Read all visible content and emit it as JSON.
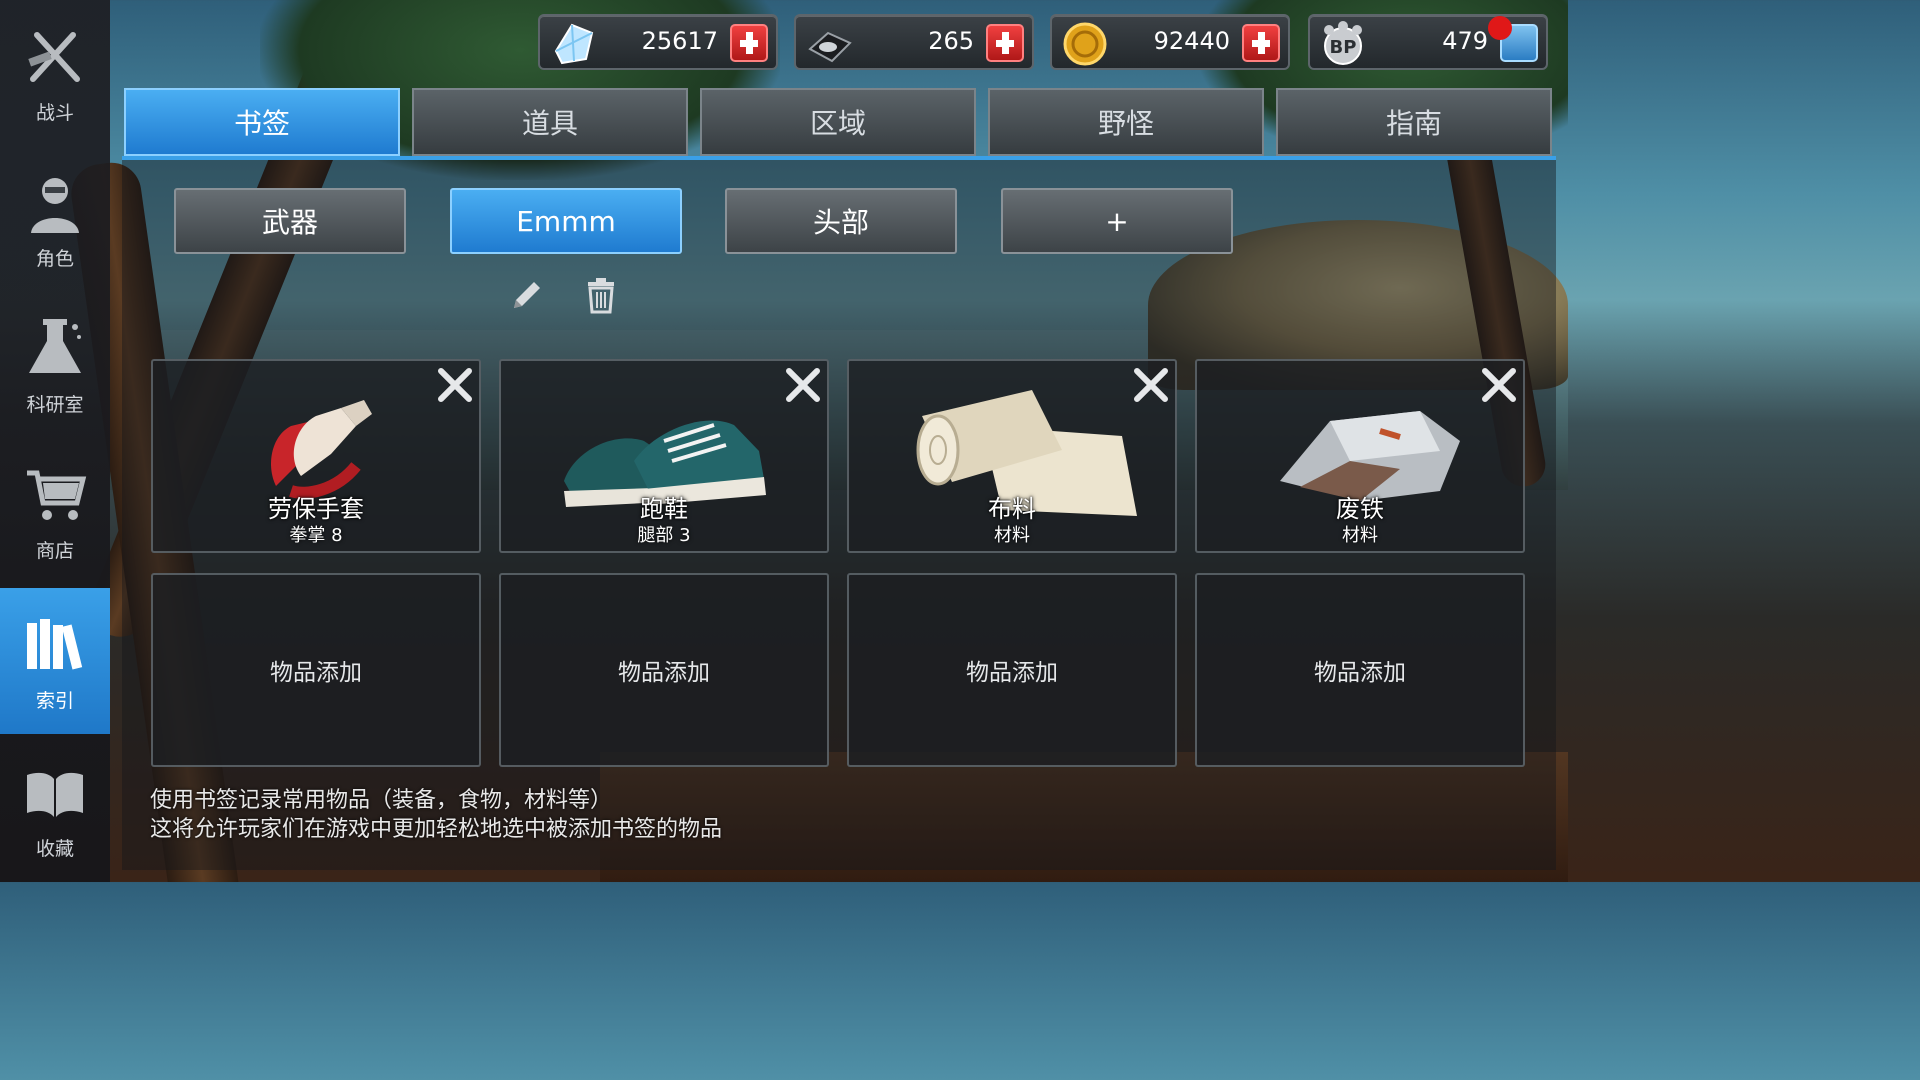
{
  "sidebar": {
    "items": [
      {
        "label": "战斗",
        "icon": "crossed-weapons-icon"
      },
      {
        "label": "角色",
        "icon": "character-icon"
      },
      {
        "label": "科研室",
        "icon": "flask-icon"
      },
      {
        "label": "商店",
        "icon": "shopping-cart-icon"
      },
      {
        "label": "索引",
        "icon": "books-icon",
        "active": true
      },
      {
        "label": "收藏",
        "icon": "open-book-icon"
      }
    ]
  },
  "resources": [
    {
      "name": "diamond",
      "icon": "diamond-icon",
      "value": "25617"
    },
    {
      "name": "disk",
      "icon": "hard-disk-icon",
      "value": "265"
    },
    {
      "name": "coin",
      "icon": "gold-coin-icon",
      "value": "92440"
    },
    {
      "name": "bp",
      "icon": "bp-badge-icon",
      "value": "479"
    }
  ],
  "tabs": [
    {
      "label": "书签",
      "active": true
    },
    {
      "label": "道具"
    },
    {
      "label": "区域"
    },
    {
      "label": "野怪"
    },
    {
      "label": "指南"
    }
  ],
  "bookmarks": [
    {
      "label": "武器"
    },
    {
      "label": "Emmm",
      "active": true
    },
    {
      "label": "头部"
    },
    {
      "label": "+"
    }
  ],
  "items": [
    {
      "name": "劳保手套",
      "sub": "拳掌 8",
      "icon": "gloves-icon"
    },
    {
      "name": "跑鞋",
      "sub": "腿部 3",
      "icon": "sneakers-icon"
    },
    {
      "name": "布料",
      "sub": "材料",
      "icon": "cloth-roll-icon"
    },
    {
      "name": "废铁",
      "sub": "材料",
      "icon": "scrap-metal-icon"
    }
  ],
  "empty_slots": [
    "物品添加",
    "物品添加",
    "物品添加",
    "物品添加"
  ],
  "hint": {
    "line1": "使用书签记录常用物品（装备，食物，材料等）",
    "line2": "这将允许玩家们在游戏中更加轻松地选中被添加书签的物品"
  },
  "colors": {
    "accent": "#2a8fe0",
    "plus": "#d82424"
  }
}
